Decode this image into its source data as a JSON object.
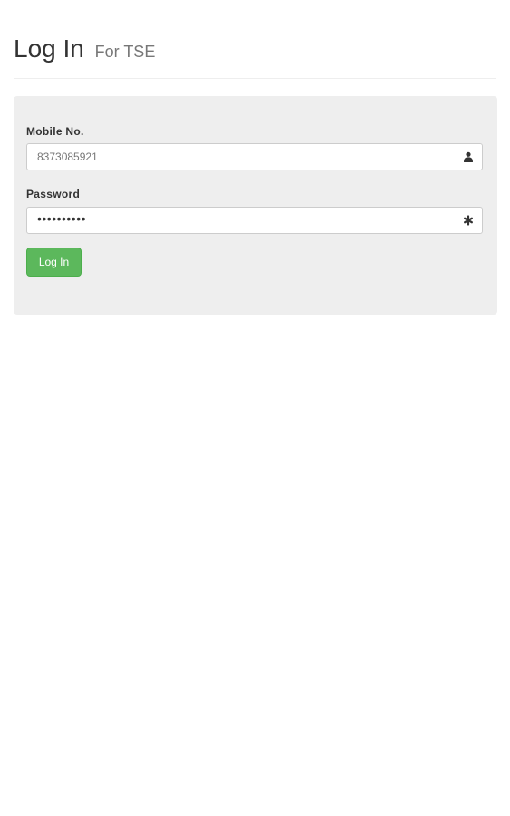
{
  "header": {
    "title": "Log In",
    "subtitle": "For TSE"
  },
  "form": {
    "mobile": {
      "label": "Mobile No.",
      "value": "8373085921",
      "icon": "user-icon"
    },
    "password": {
      "label": "Password",
      "masked_value": "••••••••••",
      "icon": "asterisk-icon"
    },
    "submit_label": "Log In"
  },
  "colors": {
    "panel_background": "#eeeeee",
    "button_green": "#5cb85c",
    "subtitle_gray": "#777777"
  }
}
